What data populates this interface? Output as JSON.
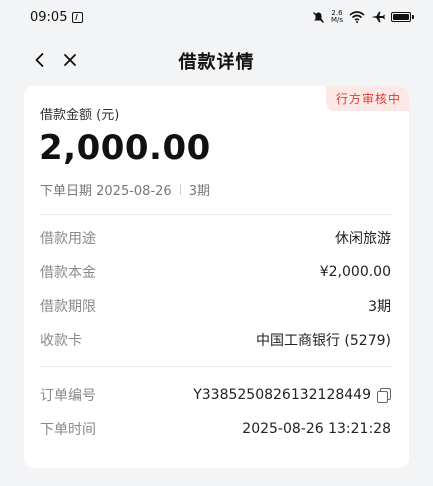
{
  "status_bar": {
    "time": "09:05",
    "speed_value": "2.6",
    "speed_unit": "M/s"
  },
  "nav": {
    "title": "借款详情",
    "back_icon": "chevron-left-icon",
    "close_icon": "close-icon"
  },
  "card": {
    "status_badge": "行方审核中",
    "amount_label": "借款金额 (元)",
    "amount_value": "2,000.00",
    "order_date": "下单日期 2025-08-26",
    "term_short": "3期",
    "rows": [
      {
        "label": "借款用途",
        "value": "休闲旅游"
      },
      {
        "label": "借款本金",
        "value": "¥2,000.00"
      },
      {
        "label": "借款期限",
        "value": "3期"
      },
      {
        "label": "收款卡",
        "value": "中国工商银行 (5279)"
      },
      {
        "label": "订单编号",
        "value": "Y3385250826132128449"
      },
      {
        "label": "下单时间",
        "value": "2025-08-26 13:21:28"
      }
    ]
  },
  "colors": {
    "badge_bg": "#fde8e8",
    "badge_text": "#e53935",
    "page_bg": "#f3f4f6"
  }
}
